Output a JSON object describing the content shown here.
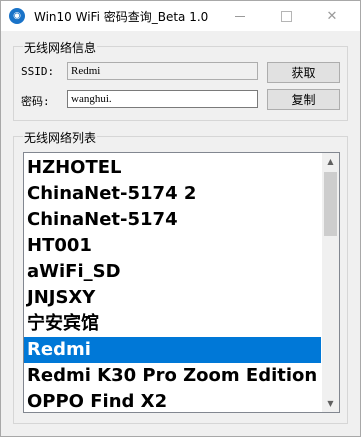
{
  "window": {
    "title": "Win10 WiFi 密码查询_Beta 1.0",
    "icon": "wifi-app-icon",
    "controls": {
      "minimize": "minimize-icon",
      "maximize": "maximize-icon",
      "close": "close-icon"
    }
  },
  "info_group": {
    "label": "无线网络信息",
    "ssid_label": "SSID:",
    "ssid_value": "Redmi",
    "password_label": "密码:",
    "password_value": "wanghui.",
    "get_button": "获取",
    "copy_button": "复制"
  },
  "list_group": {
    "label": "无线网络列表",
    "items": [
      "HZHOTEL",
      "ChinaNet-5174 2",
      "ChinaNet-5174",
      "HT001",
      "aWiFi_SD",
      "JNJSXY",
      "宁安宾馆",
      "Redmi",
      "Redmi K30 Pro Zoom Edition",
      "OPPO Find X2"
    ],
    "selected": "Redmi"
  },
  "colors": {
    "selection": "#0078d7",
    "window_bg": "#f0f0f0",
    "list_bg": "#ffffff"
  }
}
